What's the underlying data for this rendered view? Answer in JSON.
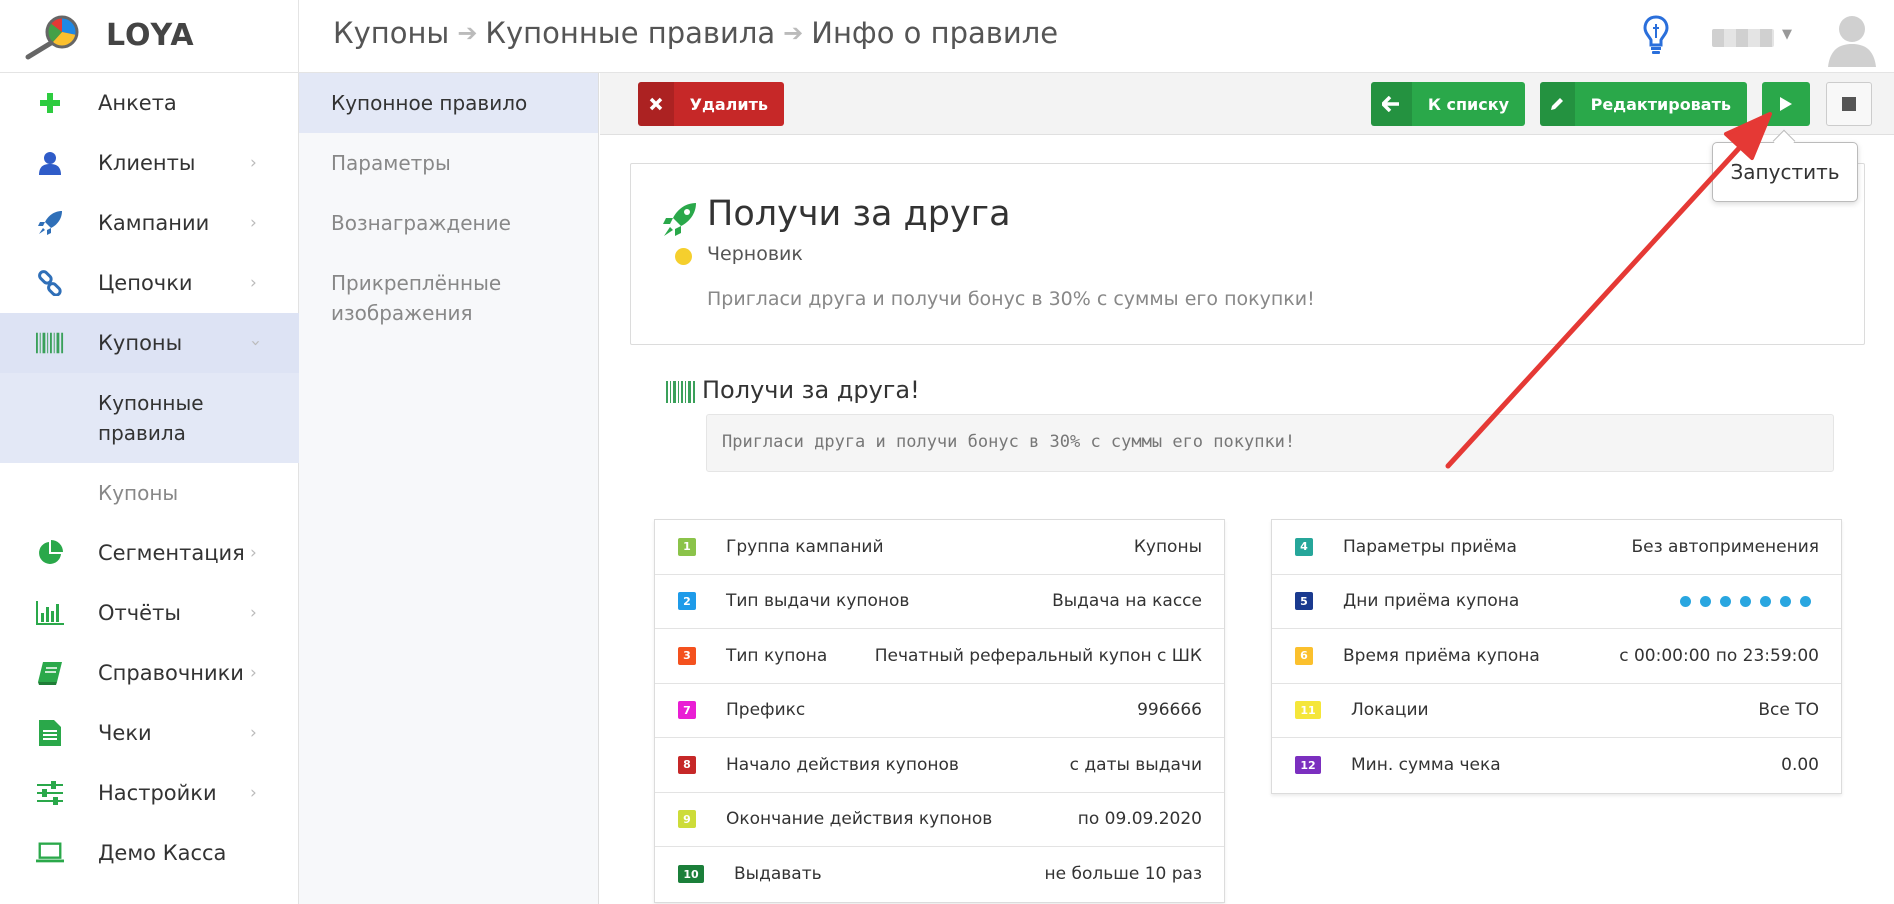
{
  "app": {
    "brand": "LOYA"
  },
  "breadcrumb": [
    "Купоны",
    "Купонные правила",
    "Инфо о правиле"
  ],
  "sidebar": {
    "items": [
      {
        "label": "Анкета",
        "icon": "plus-icon",
        "chevron": false
      },
      {
        "label": "Клиенты",
        "icon": "user-icon",
        "chevron": true
      },
      {
        "label": "Кампании",
        "icon": "rocket-icon",
        "chevron": true
      },
      {
        "label": "Цепочки",
        "icon": "link-icon",
        "chevron": true
      },
      {
        "label": "Купоны",
        "icon": "barcode-icon",
        "chevron": true
      },
      {
        "label": "Сегментация",
        "icon": "pie-chart-icon",
        "chevron": true
      },
      {
        "label": "Отчёты",
        "icon": "bar-chart-icon",
        "chevron": true
      },
      {
        "label": "Справочники",
        "icon": "book-icon",
        "chevron": true
      },
      {
        "label": "Чеки",
        "icon": "document-icon",
        "chevron": true
      },
      {
        "label": "Настройки",
        "icon": "sliders-icon",
        "chevron": true
      },
      {
        "label": "Демо Касса",
        "icon": "laptop-icon",
        "chevron": false
      }
    ],
    "sub_items": [
      {
        "label_line1": "Купонные",
        "label_line2": "правила"
      },
      {
        "label": "Купоны"
      }
    ]
  },
  "subnav": {
    "items": [
      {
        "label": "Купонное правило"
      },
      {
        "label": "Параметры"
      },
      {
        "label": "Вознаграждение"
      },
      {
        "label_line1": "Прикреплённые",
        "label_line2": "изображения"
      }
    ]
  },
  "toolbar": {
    "delete_label": "Удалить",
    "back_label": "К списку",
    "edit_label": "Редактировать",
    "tooltip": "Запустить"
  },
  "rule": {
    "title": "Получи за друга",
    "status": "Черновик",
    "description": "Пригласи друга и получи бонус в 30% с суммы его покупки!"
  },
  "coupon": {
    "name": "Получи за друга!",
    "text": "Пригласи друга и получи бонус в 30% с суммы его покупки!"
  },
  "params_left": [
    {
      "num": "1",
      "color": "#8bc34a",
      "label": "Группа кампаний",
      "value": "Купоны"
    },
    {
      "num": "2",
      "color": "#1e9be9",
      "label": "Тип выдачи купонов",
      "value": "Выдача на кассе"
    },
    {
      "num": "3",
      "color": "#f4511e",
      "label": "Тип купона",
      "value": "Печатный реферальный купон с ШК"
    },
    {
      "num": "7",
      "color": "#e91ed4",
      "label": "Префикс",
      "value": "996666"
    },
    {
      "num": "8",
      "color": "#c62828",
      "label": "Начало действия купонов",
      "value": "с даты выдачи"
    },
    {
      "num": "9",
      "color": "#cddc39",
      "label": "Окончание действия купонов",
      "value": "по 09.09.2020"
    },
    {
      "num": "10",
      "color": "#1b7f3a",
      "label": "Выдавать",
      "value": "не больше 10 раз"
    }
  ],
  "params_right": [
    {
      "num": "4",
      "color": "#26a69a",
      "label": "Параметры приёма",
      "value": "Без автоприменения"
    },
    {
      "num": "5",
      "color": "#1a3a8f",
      "label": "Дни приёма купона",
      "value": ""
    },
    {
      "num": "6",
      "color": "#fbc02d",
      "label": "Время приёма купона",
      "value": "с 00:00:00 по 23:59:00"
    },
    {
      "num": "11",
      "color": "#f5e63a",
      "label": "Локации",
      "value": "Все ТО"
    },
    {
      "num": "12",
      "color": "#7b2fbf",
      "label": "Мин. сумма чека",
      "value": "0.00"
    }
  ],
  "accept_days_count": 7
}
